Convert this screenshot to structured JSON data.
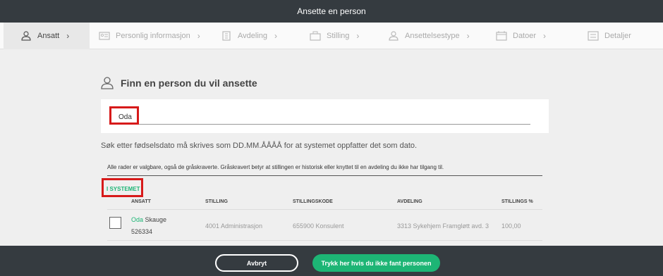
{
  "window": {
    "title": "Ansette en person"
  },
  "steps": [
    {
      "label": "Ansatt",
      "icon": "person-icon",
      "active": true
    },
    {
      "label": "Personlig informasjon",
      "icon": "id-card-icon"
    },
    {
      "label": "Avdeling",
      "icon": "building-icon"
    },
    {
      "label": "Stilling",
      "icon": "briefcase-icon"
    },
    {
      "label": "Ansettelsestype",
      "icon": "employee-type-icon"
    },
    {
      "label": "Datoer",
      "icon": "calendar-icon"
    },
    {
      "label": "Detaljer",
      "icon": "details-icon"
    }
  ],
  "page": {
    "title": "Finn en person du vil ansette"
  },
  "search": {
    "value": "Oda",
    "placeholder": ""
  },
  "help_text": "Søk etter fødselsdato må skrives som DD.MM.ÅÅÅÅ for at systemet oppfatter det som dato.",
  "info_text": "Alle rader er valgbare, også de gråskraverte. Gråskravert betyr at stillingen er historisk eller knyttet til en avdeling du ikke har tilgang til.",
  "section": {
    "label": "I SYSTEMET"
  },
  "table": {
    "columns": [
      "ANSATT",
      "STILLING",
      "STILLINGSKODE",
      "AVDELING",
      "STILLINGS %"
    ],
    "rows": [
      {
        "first_name": "Oda",
        "last_name": "Skauge",
        "employee_no": "526334",
        "position": "4001 Administrasjon",
        "position_code": "655900 Konsulent",
        "department": "3313 Sykehjem Framgløtt avd. 3",
        "percent": "100,00"
      }
    ]
  },
  "footer": {
    "cancel_label": "Avbryt",
    "not_found_label": "Trykk her hvis du ikke fant personen"
  },
  "colors": {
    "accent": "#1db575",
    "topbar": "#353b40",
    "highlight": "#d71a1a"
  }
}
